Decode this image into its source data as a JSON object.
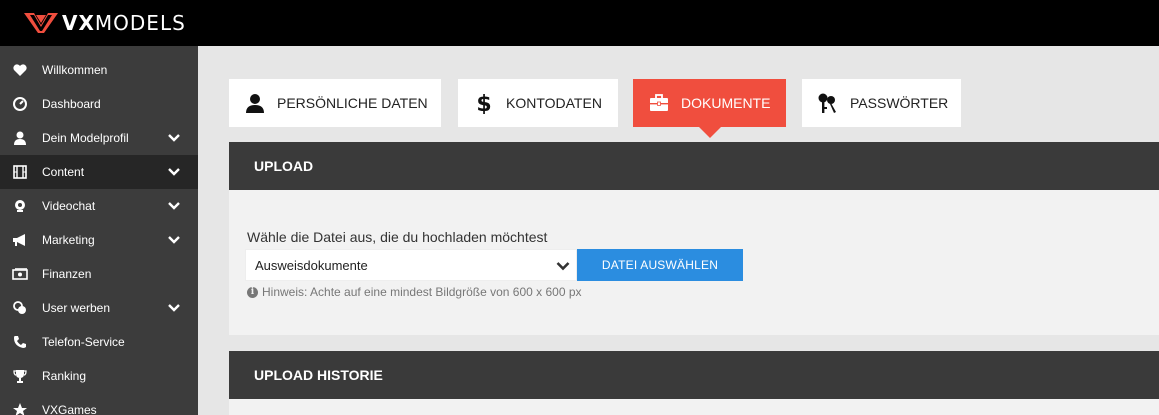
{
  "brand": {
    "logo_bold": "VX",
    "logo_light": "MODELS",
    "accent": "#f04e3e"
  },
  "sidebar": {
    "items": [
      {
        "label": "Willkommen",
        "icon": "heart-icon",
        "expandable": false,
        "active": false
      },
      {
        "label": "Dashboard",
        "icon": "gauge-icon",
        "expandable": false,
        "active": false
      },
      {
        "label": "Dein Modelprofil",
        "icon": "person-icon",
        "expandable": true,
        "active": false
      },
      {
        "label": "Content",
        "icon": "film-icon",
        "expandable": true,
        "active": true
      },
      {
        "label": "Videochat",
        "icon": "webcam-icon",
        "expandable": true,
        "active": false
      },
      {
        "label": "Marketing",
        "icon": "megaphone-icon",
        "expandable": true,
        "active": false
      },
      {
        "label": "Finanzen",
        "icon": "money-icon",
        "expandable": false,
        "active": false
      },
      {
        "label": "User werben",
        "icon": "coins-icon",
        "expandable": true,
        "active": false
      },
      {
        "label": "Telefon-Service",
        "icon": "phone-icon",
        "expandable": false,
        "active": false
      },
      {
        "label": "Ranking",
        "icon": "trophy-icon",
        "expandable": false,
        "active": false
      },
      {
        "label": "VXGames",
        "icon": "star-icon",
        "expandable": false,
        "active": false
      }
    ]
  },
  "tabs": [
    {
      "label": "PERSÖNLICHE DATEN",
      "icon": "person-icon",
      "active": false
    },
    {
      "label": "KONTODATEN",
      "icon": "dollar-icon",
      "active": false
    },
    {
      "label": "DOKUMENTE",
      "icon": "briefcase-icon",
      "active": true
    },
    {
      "label": "PASSWÖRTER",
      "icon": "keys-icon",
      "active": false
    }
  ],
  "upload": {
    "title": "UPLOAD",
    "prompt": "Wähle die Datei aus, die du hochladen möchtest",
    "document_type": "Ausweisdokumente",
    "choose_button": "DATEI AUSWÄHLEN",
    "hint": "Hinweis: Achte auf eine mindest Bildgröße von 600 x 600 px"
  },
  "history": {
    "title": "UPLOAD HISTORIE"
  }
}
